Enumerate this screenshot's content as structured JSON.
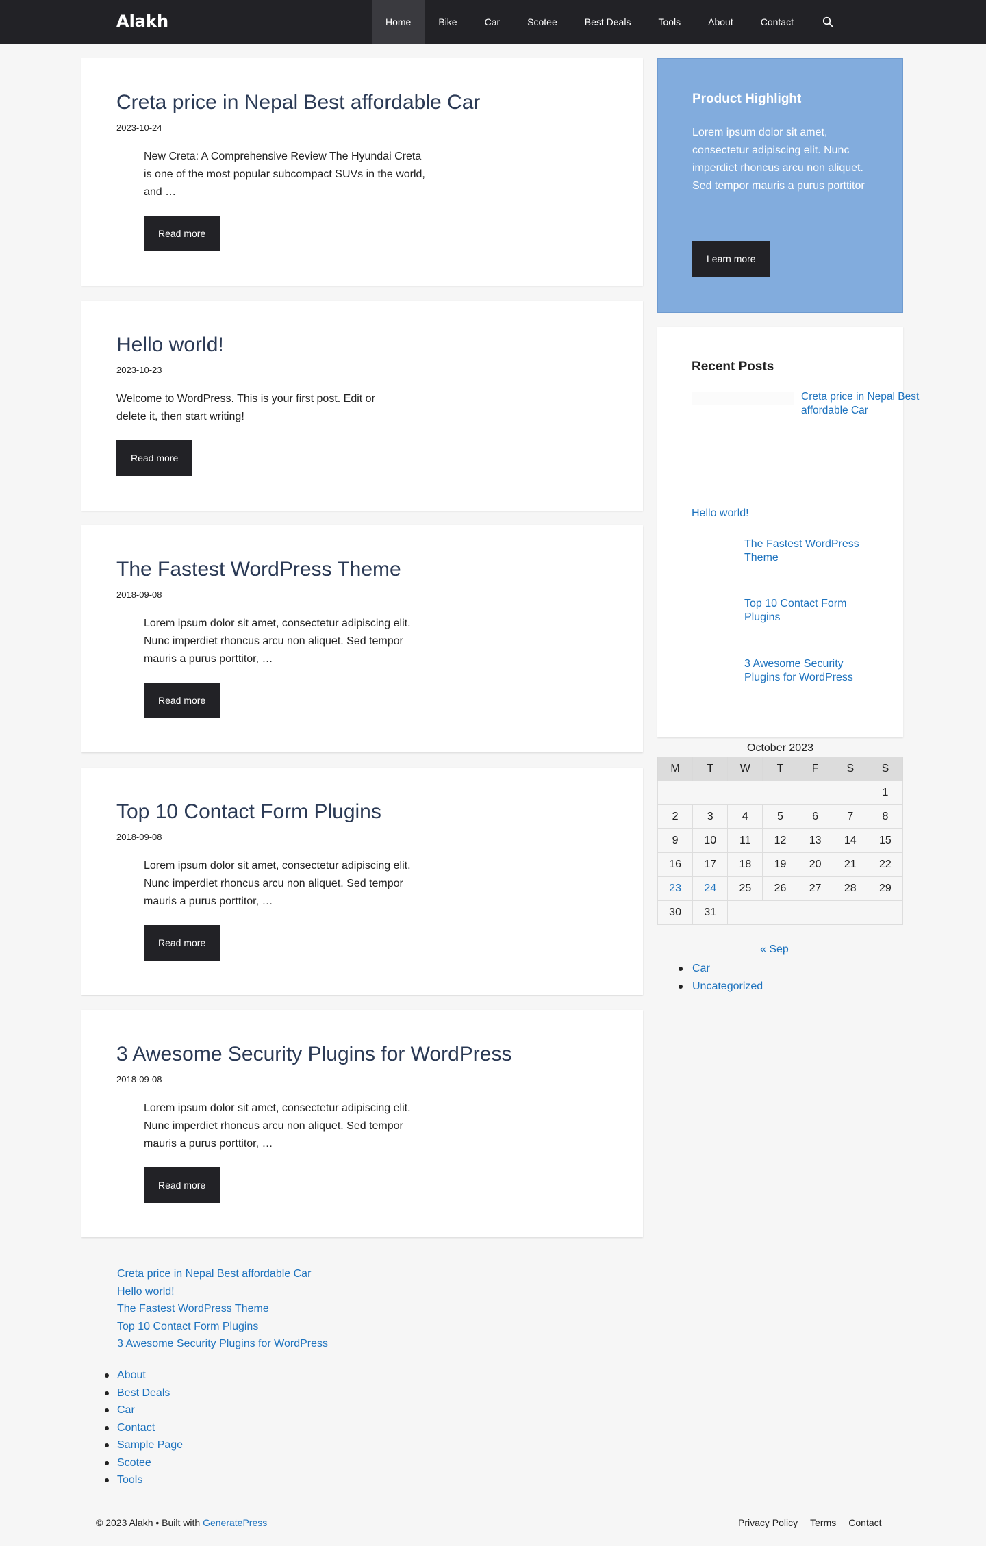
{
  "header": {
    "site_title": "Alakh",
    "nav": [
      "Home",
      "Bike",
      "Car",
      "Scotee",
      "Best Deals",
      "Tools",
      "About",
      "Contact"
    ],
    "active": "Home",
    "search_icon": "search-icon"
  },
  "posts": [
    {
      "title": "Creta price in Nepal Best affordable Car",
      "date": "2023-10-24",
      "excerpt": "New Creta: A Comprehensive Review The Hyundai Creta is one of the most popular subcompact SUVs in the world, and …",
      "button": "Read more"
    },
    {
      "title": "Hello world!",
      "date": "2023-10-23",
      "excerpt": "Welcome to WordPress. This is your first post. Edit or delete it, then start writing!",
      "button": "Read more"
    },
    {
      "title": "The Fastest WordPress Theme",
      "date": "2018-09-08",
      "excerpt": "Lorem ipsum dolor sit amet, consectetur adipiscing elit. Nunc imperdiet rhoncus arcu non aliquet. Sed tempor mauris a purus porttitor, …",
      "button": "Read more"
    },
    {
      "title": "Top 10 Contact Form Plugins",
      "date": "2018-09-08",
      "excerpt": "Lorem ipsum dolor sit amet, consectetur adipiscing elit. Nunc imperdiet rhoncus arcu non aliquet. Sed tempor mauris a purus porttitor, …",
      "button": "Read more"
    },
    {
      "title": "3 Awesome Security Plugins for WordPress",
      "date": "2018-09-08",
      "excerpt": "Lorem ipsum dolor sit amet, consectetur adipiscing elit. Nunc imperdiet rhoncus arcu non aliquet. Sed tempor mauris a purus porttitor, …",
      "button": "Read more"
    }
  ],
  "sidebar": {
    "promo": {
      "title": "Product Highlight",
      "text": "Lorem ipsum dolor sit amet, consectetur adipiscing elit. Nunc imperdiet rhoncus arcu non aliquet. Sed tempor mauris a purus porttitor",
      "button": "Learn more"
    },
    "recent": {
      "title": "Recent Posts",
      "items": [
        "Creta price in Nepal Best affordable Car",
        "Hello world!",
        "The Fastest WordPress Theme",
        "Top 10 Contact Form Plugins",
        "3 Awesome Security Plugins for WordPress"
      ]
    },
    "calendar": {
      "caption": "October 2023",
      "days": [
        "M",
        "T",
        "W",
        "T",
        "F",
        "S",
        "S"
      ],
      "linked_days": [
        "23",
        "24"
      ],
      "prev": "« Sep"
    },
    "categories": [
      "Car",
      "Uncategorized"
    ]
  },
  "footer_widgets": {
    "posts": [
      "Creta price in Nepal Best affordable Car",
      "Hello world!",
      "The Fastest WordPress Theme",
      "Top 10 Contact Form Plugins",
      "3 Awesome Security Plugins for WordPress"
    ],
    "pages": [
      "About",
      "Best Deals",
      "Car",
      "Contact",
      "Sample Page",
      "Scotee",
      "Tools"
    ]
  },
  "footer": {
    "copyright": "© 2023 Alakh • Built with ",
    "built_with": "GeneratePress",
    "links": [
      "Privacy Policy",
      "Terms",
      "Contact"
    ]
  },
  "colors": {
    "header_bg": "#222226",
    "accent": "#1e73be",
    "promo_bg": "#82acdd",
    "title": "#2b3a55"
  }
}
